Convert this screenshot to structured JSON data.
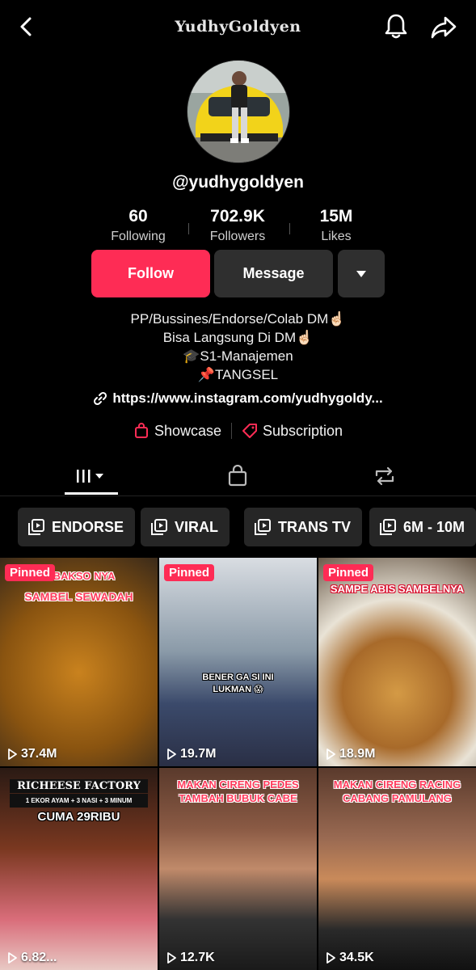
{
  "header": {
    "title": "YudhyGoldyen",
    "back_icon": "chevron-left-icon",
    "bell_icon": "bell-icon",
    "share_icon": "share-arrow-icon"
  },
  "profile": {
    "handle": "@yudhygoldyen",
    "stats": [
      {
        "value": "60",
        "label": "Following"
      },
      {
        "value": "702.9K",
        "label": "Followers"
      },
      {
        "value": "15M",
        "label": "Likes"
      }
    ],
    "buttons": {
      "follow": "Follow",
      "message": "Message"
    },
    "bio": [
      "PP/Bussines/Endorse/Colab DM☝🏻",
      "Bisa Langsung Di DM☝🏻",
      "🎓S1-Manajemen",
      "📌TANGSEL"
    ],
    "link": "https://www.instagram.com/yudhygoldy...",
    "shortcuts": {
      "showcase": "Showcase",
      "subscription": "Subscription"
    }
  },
  "playlists": [
    "ENDORSE",
    "VIRAL",
    "TRANS TV",
    "6M - 10M"
  ],
  "videos": [
    {
      "pinned": "Pinned",
      "views": "37.4M",
      "caption": [
        "N BAKSO NYA",
        "SAMBEL SEWADAH"
      ]
    },
    {
      "pinned": "Pinned",
      "views": "19.7M",
      "caption": [
        "BENER GA SI INI",
        "LUKMAN 😱"
      ]
    },
    {
      "pinned": "Pinned",
      "views": "18.9M",
      "caption": [
        "SAMPE ABIS SAMBELNYA"
      ]
    },
    {
      "pinned": "",
      "views": "6.82...",
      "caption": [
        "RICHEESE FACTORY",
        "1 EKOR AYAM + 3 NASI + 3 MINUM",
        "CUMA 29RIBU"
      ]
    },
    {
      "pinned": "",
      "views": "12.7K",
      "caption": [
        "MAKAN CIRENG PEDES",
        "TAMBAH BUBUK CABE"
      ]
    },
    {
      "pinned": "",
      "views": "34.5K",
      "caption": [
        "MAKAN CIRENG RACING",
        "CABANG PAMULANG"
      ]
    }
  ],
  "colors": {
    "accent": "#fe2c55",
    "background": "#000000",
    "button_dark": "#2f2f2f"
  }
}
